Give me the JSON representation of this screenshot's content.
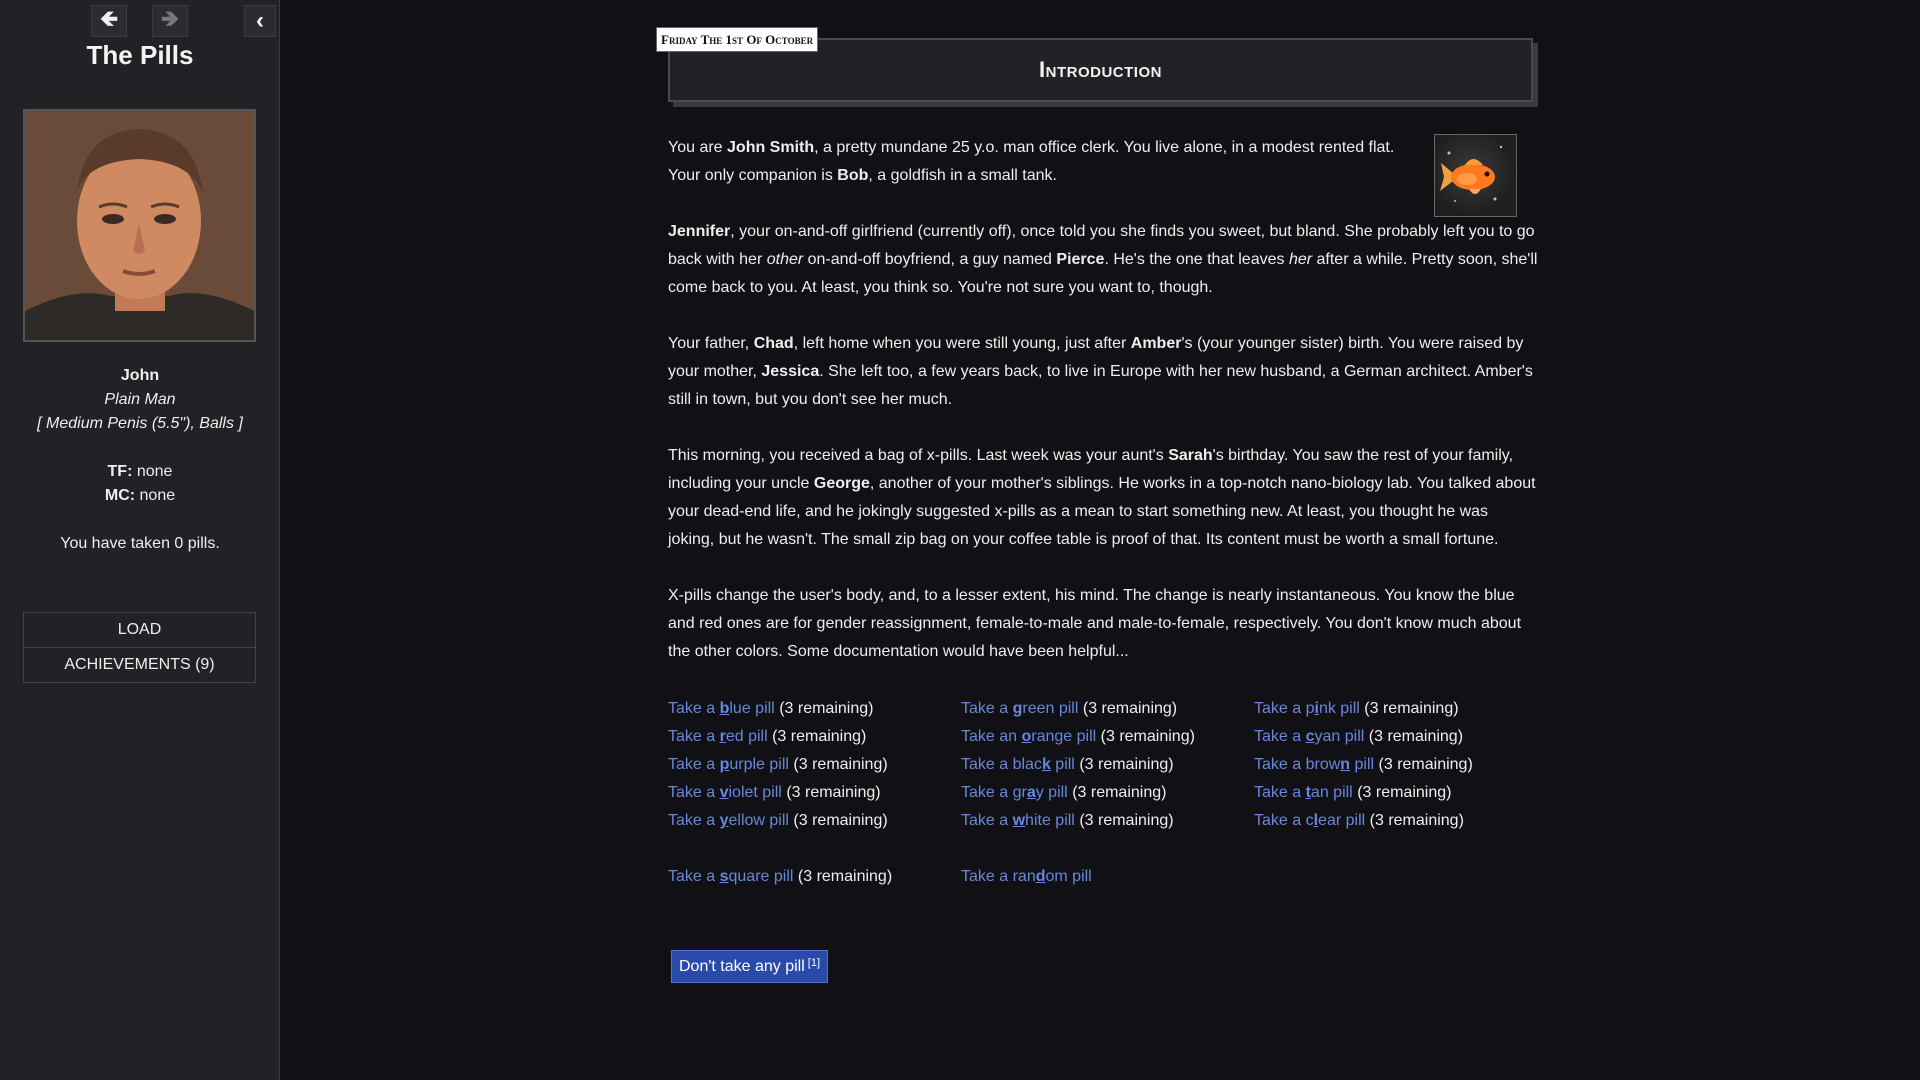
{
  "sidebar": {
    "back_icon": "arrow-left-icon",
    "forward_icon": "arrow-right-icon",
    "toggle_icon": "chevron-left-icon",
    "title": "The Pills",
    "character": {
      "name": "John",
      "type": "Plain Man",
      "attributes": "[ Medium Penis (5.5\"), Balls ]",
      "tf_label": "TF:",
      "tf_value": "none",
      "mc_label": "MC:",
      "mc_value": "none",
      "pills_text": "You have taken 0 pills."
    },
    "menu": {
      "load": "LOAD",
      "achievements": "ACHIEVEMENTS (9)"
    }
  },
  "passage": {
    "date": "Friday The 1st Of October",
    "heading": "Introduction",
    "p1": {
      "a": "You are ",
      "b": "John Smith",
      "c": ", a pretty mundane 25 y.o. man office clerk. You live alone, in a modest rented flat. Your only companion is ",
      "d": "Bob",
      "e": ", a goldfish in a small tank."
    },
    "p2": {
      "a": "Jennifer",
      "b": ", your on-and-off girlfriend (currently off), once told you she finds you sweet, but bland. She probably left you to go back with her ",
      "c": "other",
      "d": " on-and-off boyfriend, a guy named ",
      "e": "Pierce",
      "f": ". He's the one that leaves ",
      "g": "her",
      "h": " after a while. Pretty soon, she'll come back to you. At least, you think so. You're not sure you want to, though."
    },
    "p3": {
      "a": "Your father, ",
      "b": "Chad",
      "c": ", left home when you were still young, just after ",
      "d": "Amber",
      "e": "'s (your younger sister) birth. You were raised by your mother, ",
      "f": "Jessica",
      "g": ". She left too, a few years back, to live in Europe with her new husband, a German architect. Amber's still in town, but you don't see her much."
    },
    "p4": {
      "a": "This morning, you received a bag of x-pills. Last week was your aunt's ",
      "b": "Sarah",
      "c": "'s birthday. You saw the rest of your family, including your uncle ",
      "d": "George",
      "e": ", another of your mother's siblings. He works in a top-notch nano-biology lab. You talked about your dead-end life, and he jokingly suggested x-pills as a mean to start something new. At least, you thought he was joking, but he wasn't. The small zip bag on your coffee table is proof of that. Its content must be worth a small fortune."
    },
    "p5": "X-pills change the user's body, and, to a lesser extent, his mind. The change is nearly instantaneous. You know the blue and red ones are for gender reassignment, female-to-male and male-to-female, respectively. You don't know much about the other colors. Some documentation would have been helpful...",
    "remaining": "(3 remaining)",
    "pills_col1": [
      {
        "pre": "Take a ",
        "key": "b",
        "post": "lue pill"
      },
      {
        "pre": "Take a ",
        "key": "r",
        "post": "ed pill"
      },
      {
        "pre": "Take a ",
        "key": "p",
        "post": "urple pill"
      },
      {
        "pre": "Take a ",
        "key": "v",
        "post": "iolet pill"
      },
      {
        "pre": "Take a ",
        "key": "y",
        "post": "ellow pill"
      }
    ],
    "pills_col2": [
      {
        "pre": "Take a ",
        "key": "g",
        "post": "reen pill"
      },
      {
        "pre": "Take an ",
        "key": "o",
        "post": "range pill"
      },
      {
        "pre": "Take a blac",
        "key": "k",
        "post": " pill"
      },
      {
        "pre": "Take a gr",
        "key": "a",
        "post": "y pill"
      },
      {
        "pre": "Take a ",
        "key": "w",
        "post": "hite pill"
      }
    ],
    "pills_col3": [
      {
        "pre": "Take a p",
        "key": "i",
        "post": "nk pill"
      },
      {
        "pre": "Take a ",
        "key": "c",
        "post": "yan pill"
      },
      {
        "pre": "Take a brow",
        "key": "n",
        "post": " pill"
      },
      {
        "pre": "Take a ",
        "key": "t",
        "post": "an pill"
      },
      {
        "pre": "Take a c",
        "key": "l",
        "post": "ear pill"
      }
    ],
    "square": {
      "pre": "Take a ",
      "key": "s",
      "post": "quare pill"
    },
    "random": {
      "pre": "Take a ran",
      "key": "d",
      "post": "om pill"
    },
    "no_pill_label": "Don't take any pill",
    "no_pill_sup": "[1]"
  },
  "colors": {
    "background": "#111115",
    "sidebar": "#222226",
    "link": "#6688dd",
    "button": "#2a4aaa"
  }
}
